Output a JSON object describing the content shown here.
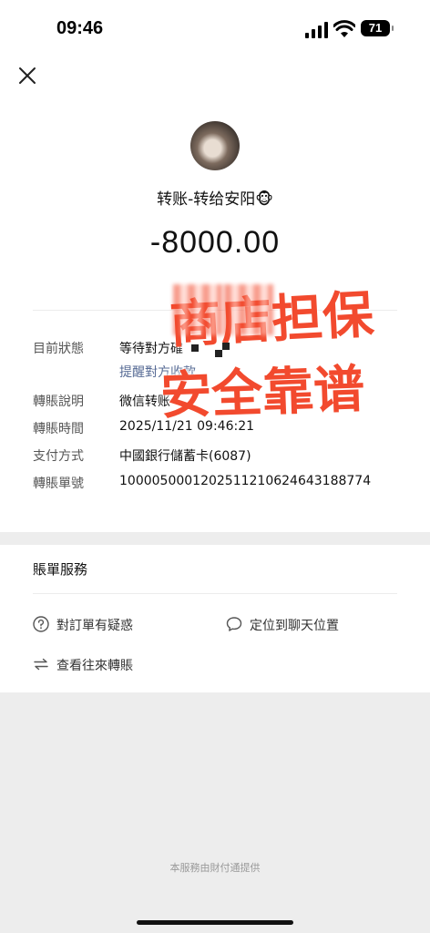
{
  "status_bar": {
    "time": "09:46",
    "battery": "71"
  },
  "header": {
    "close_icon": "close-icon"
  },
  "transfer": {
    "title": "转账-转给安阳🐵",
    "amount": "-8000.00"
  },
  "details": [
    {
      "label": "目前狀態",
      "value": "等待對方確"
    },
    {
      "label": "轉賬說明",
      "value": "微信转账"
    },
    {
      "label": "轉賬時間",
      "value": "2025/11/21 09:46:21"
    },
    {
      "label": "支付方式",
      "value": "中國銀行儲蓄卡(6087)"
    },
    {
      "label": "轉賬單號",
      "value": "1000050001202511210624643188774"
    }
  ],
  "remind_link": "提醒對方收款",
  "overlay": {
    "line1": "商店担保",
    "line2": "安全靠谱",
    "color": "#f24a2e"
  },
  "services": {
    "title": "賬單服務",
    "items": [
      {
        "label": "對訂單有疑惑",
        "icon": "question-circle-icon"
      },
      {
        "label": "定位到聊天位置",
        "icon": "chat-bubble-icon"
      },
      {
        "label": "查看往來轉賬",
        "icon": "transfer-arrows-icon"
      }
    ]
  },
  "footer": {
    "text": "本服務由財付通提供"
  },
  "colors": {
    "link": "#576b95",
    "background": "#ededed"
  }
}
